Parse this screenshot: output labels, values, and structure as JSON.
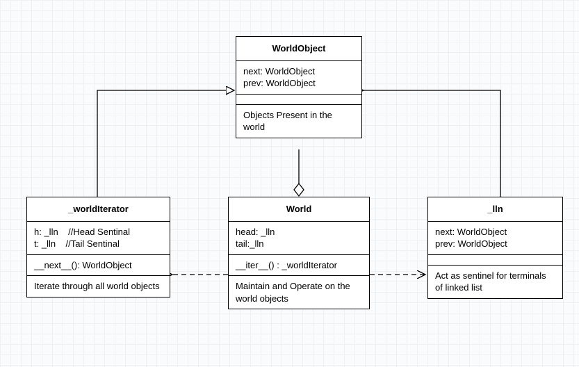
{
  "classes": {
    "WorldObject": {
      "name": "WorldObject",
      "attrs": [
        "next: WorldObject",
        "prev: WorldObject"
      ],
      "ops": [],
      "note": "Objects Present in the world"
    },
    "worldIterator": {
      "name": "_worldIterator",
      "attrs": [
        "h: _lln    //Head Sentinal",
        "t: _lln    //Tail Sentinal"
      ],
      "ops": [
        "__next__(): WorldObject"
      ],
      "note": "Iterate through all world objects"
    },
    "World": {
      "name": "World",
      "attrs": [
        "head: _lln",
        "tail:_lln"
      ],
      "ops": [
        "__iter__() : _worldIterator"
      ],
      "note": " Maintain and Operate on the world objects"
    },
    "lln": {
      "name": "_lln",
      "attrs": [
        "next: WorldObject",
        "prev: WorldObject"
      ],
      "ops": [],
      "note": "Act as sentinel for terminals of linked list"
    }
  },
  "relations": [
    {
      "from": "World",
      "to": "WorldObject",
      "type": "aggregation",
      "style": "solid"
    },
    {
      "from": "worldIterator",
      "to": "WorldObject",
      "type": "generalization",
      "style": "solid"
    },
    {
      "from": "lln",
      "to": "WorldObject",
      "type": "generalization",
      "style": "solid"
    },
    {
      "from": "World",
      "to": "worldIterator",
      "type": "dependency",
      "style": "dashed"
    },
    {
      "from": "World",
      "to": "lln",
      "type": "dependency",
      "style": "dashed"
    }
  ]
}
